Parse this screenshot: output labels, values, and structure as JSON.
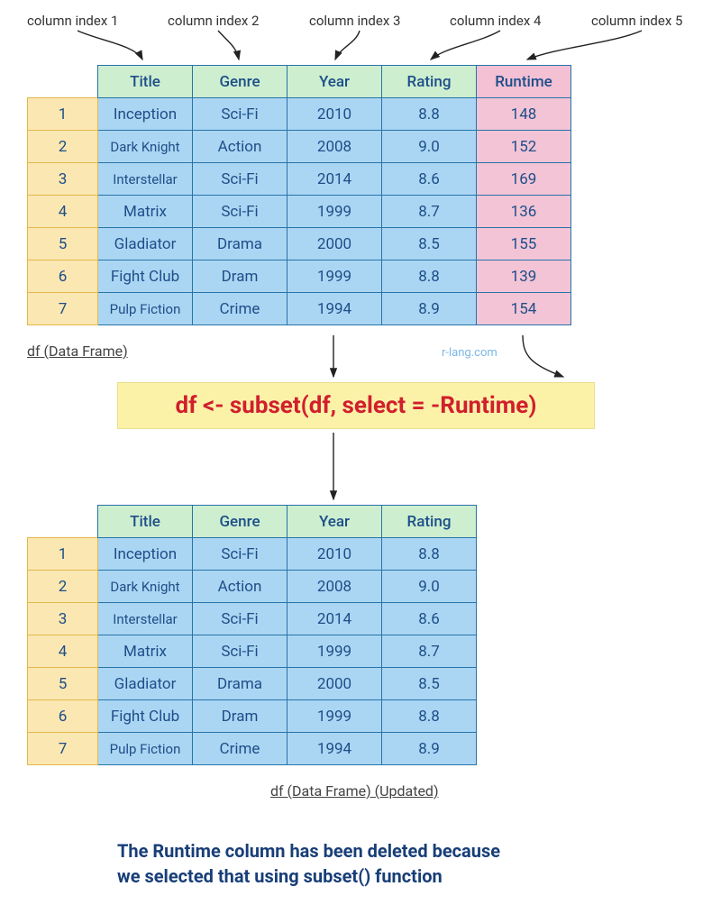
{
  "col_labels": [
    "column index 1",
    "column index 2",
    "column index 3",
    "column index 4",
    "column index 5"
  ],
  "headers": [
    "Title",
    "Genre",
    "Year",
    "Rating",
    "Runtime"
  ],
  "rows": [
    {
      "idx": "1",
      "title": "Inception",
      "genre": "Sci-Fi",
      "year": "2010",
      "rating": "8.8",
      "runtime": "148",
      "sm": false
    },
    {
      "idx": "2",
      "title": "Dark Knight",
      "genre": "Action",
      "year": "2008",
      "rating": "9.0",
      "runtime": "152",
      "sm": true
    },
    {
      "idx": "3",
      "title": "Interstellar",
      "genre": "Sci-Fi",
      "year": "2014",
      "rating": "8.6",
      "runtime": "169",
      "sm": true
    },
    {
      "idx": "4",
      "title": "Matrix",
      "genre": "Sci-Fi",
      "year": "1999",
      "rating": "8.7",
      "runtime": "136",
      "sm": false
    },
    {
      "idx": "5",
      "title": "Gladiator",
      "genre": "Drama",
      "year": "2000",
      "rating": "8.5",
      "runtime": "155",
      "sm": false
    },
    {
      "idx": "6",
      "title": "Fight Club",
      "genre": "Dram",
      "year": "1999",
      "rating": "8.8",
      "runtime": "139",
      "sm": false
    },
    {
      "idx": "7",
      "title": "Pulp Fiction",
      "genre": "Crime",
      "year": "1994",
      "rating": "8.9",
      "runtime": "154",
      "sm": true
    }
  ],
  "caption1": "df (Data Frame)",
  "watermark": "r-lang.com",
  "code": "df <- subset(df, select = -Runtime)",
  "headers2": [
    "Title",
    "Genre",
    "Year",
    "Rating"
  ],
  "caption2": "df (Data Frame) (Updated)",
  "footer_line1": "The Runtime column has been deleted because",
  "footer_line2": "we selected that using subset() function",
  "colors": {
    "idx_bg": "#fbe7b2",
    "hdr_bg": "#cdeecf",
    "data_bg": "#abd6f3",
    "runtime_bg": "#f3c4d6",
    "code_bg": "#fbf2a8",
    "code_fg": "#d11f2d"
  }
}
